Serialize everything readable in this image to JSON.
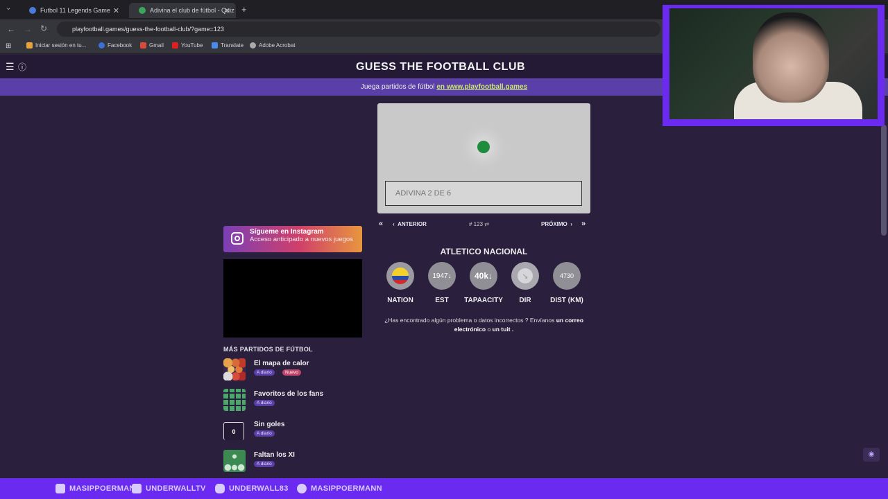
{
  "browser": {
    "tabs": [
      {
        "label": "Futbol 11 Legends Game",
        "active": false
      },
      {
        "label": "Adivina el club de fútbol - Quiz",
        "active": true
      }
    ],
    "url": "playfootball.games/guess-the-football-club/?game=123",
    "bookmarks": [
      "Iniciar sesión en tu...",
      "Facebook",
      "Gmail",
      "YouTube",
      "Translate",
      "Adobe Acrobat"
    ]
  },
  "site": {
    "title": "GUESS THE FOOTBALL CLUB",
    "promo_text": "Juega partidos de fútbol",
    "promo_link": "en www.playfootball.games"
  },
  "game": {
    "input_placeholder": "ADIVINA 2 DE 6",
    "prev_label": "ANTERIOR",
    "next_label": "PRÓXIMO",
    "game_number": "# 123",
    "club_name": "ATLETICO NACIONAL",
    "clues": [
      {
        "label": "NATION",
        "value": ""
      },
      {
        "label": "EST",
        "value": "1947↓"
      },
      {
        "label": "TAPAACITY",
        "value": "40k↓"
      },
      {
        "label": "DIR",
        "value": "↘"
      },
      {
        "label": "DIST (KM)",
        "value": "4730"
      }
    ],
    "report_prefix": "¿Has encontrado algún problema o datos incorrectos ? Envíanos",
    "report_email": "un correo electrónico",
    "report_or": "o",
    "report_tweet": "un tuit",
    "report_end": "."
  },
  "instagram": {
    "title": "Sígueme en Instagram",
    "subtitle": "Acceso anticipado a nuevos juegos"
  },
  "more_games": {
    "title": "MÁS PARTIDOS DE FÚTBOL",
    "items": [
      {
        "name": "El mapa de calor",
        "badge": "A diario",
        "extra_badge": "Nuevo"
      },
      {
        "name": "Favoritos de los fans",
        "badge": "A diario"
      },
      {
        "name": "Sin goles",
        "badge": "A diario",
        "icon_text": "0"
      },
      {
        "name": "Faltan los XI",
        "badge": "A diario"
      }
    ]
  },
  "stream_bar": [
    "MASIPPOERMAN",
    "UNDERWALLTV",
    "UNDERWALL83",
    "MASIPPOERMANN"
  ]
}
